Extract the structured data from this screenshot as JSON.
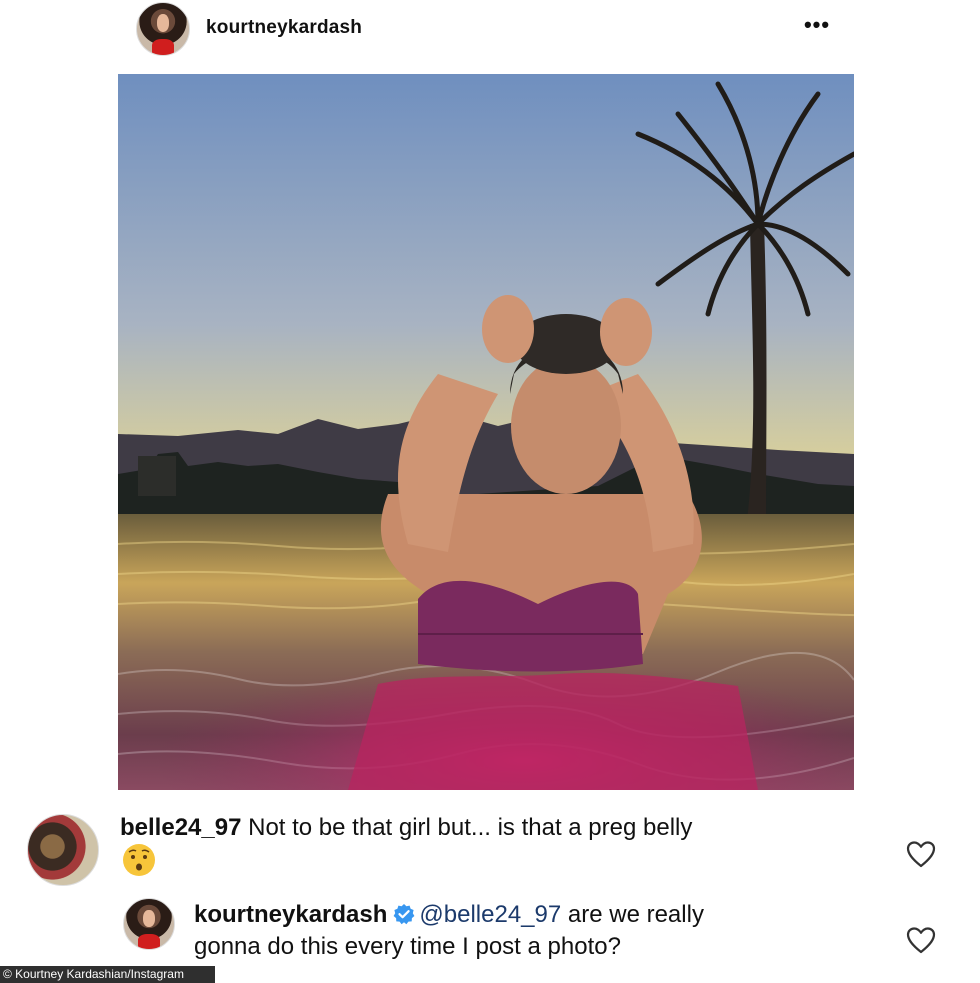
{
  "post": {
    "username": "kourtneykardash",
    "more_icon": "more-horizontal-icon",
    "more_glyph": "•••"
  },
  "comments": [
    {
      "username": "belle24_97",
      "text": "Not to be that girl but... is that a preg belly",
      "emoji": "hushed-face-emoji",
      "like_icon": "heart-outline-icon"
    },
    {
      "username": "kourtneykardash",
      "verified": true,
      "mention": "@belle24_97",
      "text_line1": "are we really",
      "text_line2": "gonna do this every time I post a photo?",
      "like_icon": "heart-outline-icon"
    }
  ],
  "credit": "© Kourtney Kardashian/Instagram",
  "colors": {
    "verified_blue": "#3897f0",
    "mention_blue": "#1c3a6b",
    "credit_bg": "#2f2f2f"
  }
}
